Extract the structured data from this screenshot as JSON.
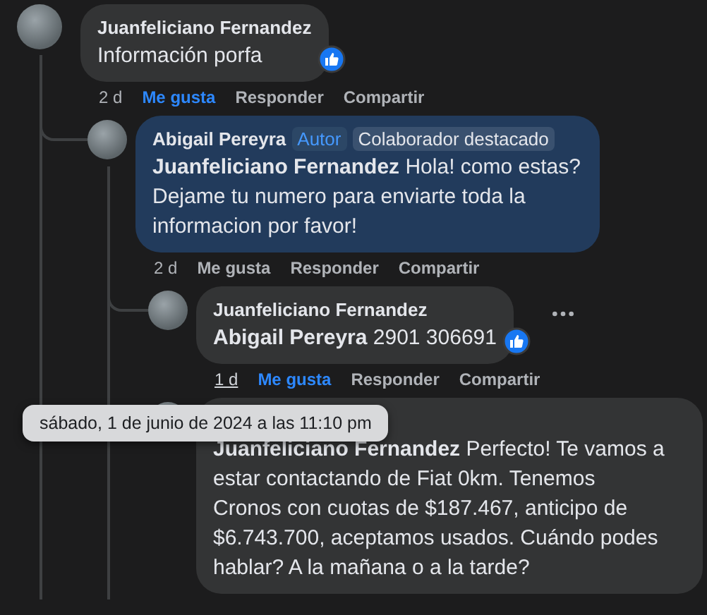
{
  "comments": [
    {
      "author": "Juanfeliciano Fernandez",
      "text": "Información porfa",
      "highlighted": false,
      "liked": true,
      "time": "2 d",
      "time_hovered": false,
      "actions": [
        {
          "label": "Me gusta",
          "selected": true
        },
        {
          "label": "Responder",
          "selected": false
        },
        {
          "label": "Compartir",
          "selected": false
        }
      ],
      "more_menu": false,
      "children": [
        {
          "author": "Abigail Pereyra",
          "badges": [
            {
              "label": "Autor",
              "kind": "author"
            },
            {
              "label": "Colaborador destacado",
              "kind": "contributor"
            }
          ],
          "text": "**Juanfeliciano Fernandez** Hola! como estas? Dejame tu numero para enviarte toda la informacion por favor!",
          "highlighted": true,
          "liked": false,
          "time": "2 d",
          "time_hovered": false,
          "actions": [
            {
              "label": "Me gusta",
              "selected": false
            },
            {
              "label": "Responder",
              "selected": false
            },
            {
              "label": "Compartir",
              "selected": false
            }
          ],
          "more_menu": false,
          "children": [
            {
              "author": "Juanfeliciano Fernandez",
              "text": "**Abigail Pereyra** 2901 306691",
              "highlighted": false,
              "liked": true,
              "time": "1 d",
              "time_hovered": true,
              "tooltip": "sábado, 1 de junio de 2024 a las 11:10 pm",
              "actions": [
                {
                  "label": "Me gusta",
                  "selected": true
                },
                {
                  "label": "Responder",
                  "selected": false
                },
                {
                  "label": "Compartir",
                  "selected": false
                }
              ],
              "more_menu": true
            },
            {
              "text": "**Juanfeliciano Fernandez** Perfecto! Te vamos a estar contactando de Fiat 0km. Tenemos Cronos con cuotas de $187.467, anticipo de $6.743.700, aceptamos usados. Cuándo podes hablar? A la mañana o a la tarde?",
              "highlighted": false,
              "liked": false,
              "more_menu": false
            }
          ]
        }
      ]
    }
  ]
}
